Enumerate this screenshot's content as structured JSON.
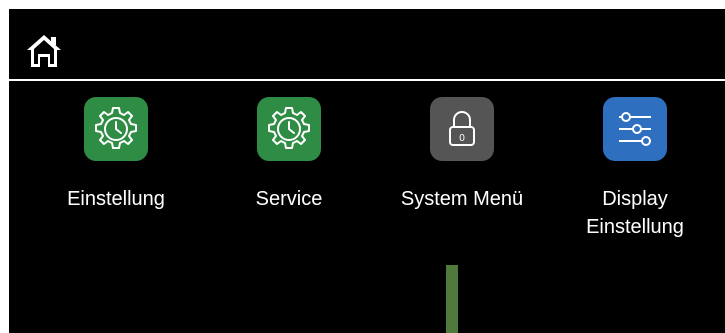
{
  "header": {
    "home_icon": "home-icon"
  },
  "tiles": [
    {
      "label_line1": "Einstellung",
      "label_line2": "",
      "icon": "gear-clock-icon",
      "color": "#2f8c45"
    },
    {
      "label_line1": "Service",
      "label_line2": "",
      "icon": "gear-clock-icon",
      "color": "#2f8c45"
    },
    {
      "label_line1": "System Menü",
      "label_line2": "",
      "icon": "lock-icon",
      "color": "#555555"
    },
    {
      "label_line1": "Display",
      "label_line2": "Einstellung",
      "icon": "sliders-icon",
      "color": "#2f6fbf"
    }
  ],
  "lock_badge": "0",
  "colors": {
    "background": "#000000",
    "divider": "#ffffff",
    "level_bar": "#4f7a3c"
  }
}
